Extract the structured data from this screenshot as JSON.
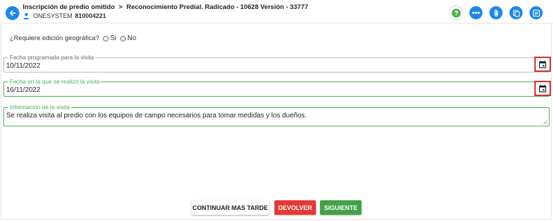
{
  "header": {
    "breadcrumb": [
      "Inscripción de predio omitido",
      "Reconocimiento Predial. Radicado - 10628 Versión - 33777"
    ],
    "breadcrumb_separator": ">",
    "user_name": "ONESYSTEM",
    "user_id": "810004221",
    "icons": [
      "back-arrow-icon",
      "help-icon",
      "flow-icon",
      "attachment-icon",
      "documents-icon",
      "notes-icon"
    ]
  },
  "form": {
    "geo_question": "¿Requiere edición geográfica?",
    "geo_options": [
      "Si",
      "No"
    ],
    "fecha_programada": {
      "label": "Fecha programada para la visita",
      "value": "10/11/2022"
    },
    "fecha_realizada": {
      "label": "Fecha en la que se realizó la visita",
      "value": "16/11/2022"
    },
    "informacion": {
      "label": "Información de la visita",
      "value": "Se realiza visita al predio con los equipos de campo necesarios para tomar medidas y los dueños."
    }
  },
  "actions": {
    "continuar": "CONTINUAR MAS TARDE",
    "devolver": "DEVOLVER",
    "siguiente": "SIGUIENTE"
  },
  "colors": {
    "primary": "#1e88e5",
    "accent_green": "#4caf50",
    "danger": "#e53935",
    "highlight_border": "#d32f2f"
  }
}
